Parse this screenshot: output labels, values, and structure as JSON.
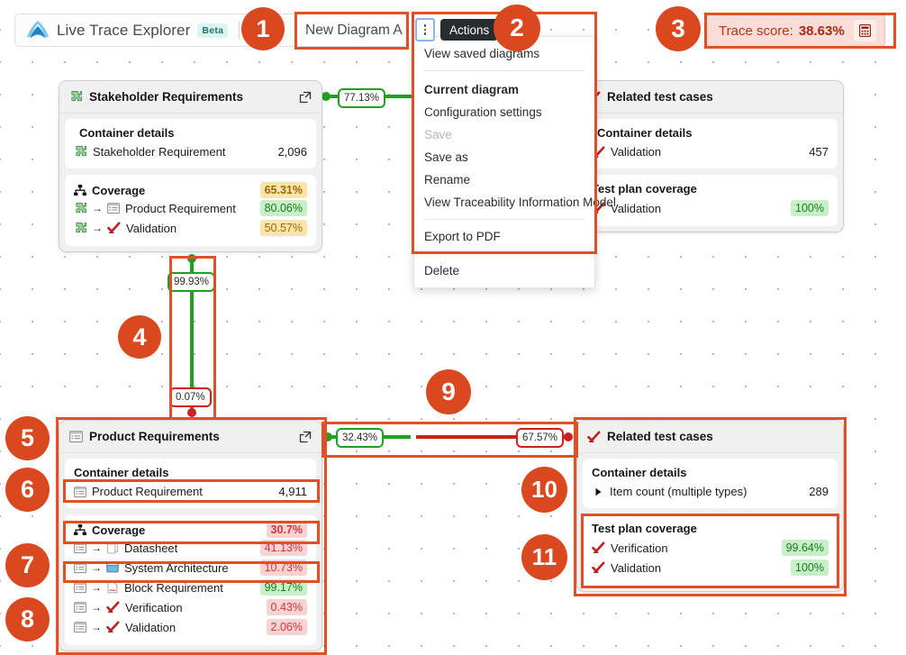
{
  "app": {
    "title": "Live Trace Explorer",
    "badge": "Beta",
    "logo_icon": "live-trace-logo-icon"
  },
  "diagram_name": {
    "value": "New Diagram A"
  },
  "actions": {
    "button_icon": "kebab-menu-icon",
    "tooltip": "Actions",
    "menu": [
      {
        "label": "View saved diagrams",
        "type": "item"
      },
      {
        "type": "separator"
      },
      {
        "label": "Current diagram",
        "type": "header"
      },
      {
        "label": "Configuration settings",
        "type": "item"
      },
      {
        "label": "Save",
        "type": "disabled"
      },
      {
        "label": "Save as",
        "type": "item"
      },
      {
        "label": "Rename",
        "type": "item"
      },
      {
        "label": "View Traceability Information Model",
        "type": "item"
      },
      {
        "type": "separator"
      },
      {
        "label": "Export to PDF",
        "type": "item"
      },
      {
        "type": "separator"
      },
      {
        "label": "Delete",
        "type": "item"
      }
    ]
  },
  "trace_score": {
    "label": "Trace score:",
    "value": "38.63%",
    "icon": "calculator-icon",
    "color": "#b03520",
    "background": "#fbdcd6"
  },
  "cards": {
    "stakeholder": {
      "title": "Stakeholder Requirements",
      "icon": "puzzle-piece-icon",
      "open_icon": "external-link-icon",
      "details_title": "Container details",
      "details_rows": [
        {
          "icon": "puzzle-piece-icon",
          "label": "Stakeholder Requirement",
          "value": "2,096"
        }
      ],
      "coverage_title": "Coverage",
      "coverage_icon": "hierarchy-icon",
      "coverage_value": "65.31%",
      "coverage_color": "amber",
      "coverage_rows": [
        {
          "from_icon": "puzzle-piece-icon",
          "to_icon": "table-icon",
          "label": "Product Requirement",
          "value": "80.06%",
          "color": "green"
        },
        {
          "from_icon": "puzzle-piece-icon",
          "to_icon": "check-mark-icon",
          "label": "Validation",
          "value": "50.57%",
          "color": "amber"
        }
      ]
    },
    "product": {
      "title": "Product Requirements",
      "icon": "table-icon",
      "open_icon": "external-link-icon",
      "details_title": "Container details",
      "details_rows": [
        {
          "icon": "table-icon",
          "label": "Product Requirement",
          "value": "4,911"
        }
      ],
      "coverage_title": "Coverage",
      "coverage_icon": "hierarchy-icon",
      "coverage_value": "30.7%",
      "coverage_color": "red",
      "coverage_rows": [
        {
          "from_icon": "table-icon",
          "to_icon": "copy-icon",
          "label": "Datasheet",
          "value": "41.13%",
          "color": "red"
        },
        {
          "from_icon": "table-icon",
          "to_icon": "window-icon",
          "label": "System Architecture",
          "value": "10.73%",
          "color": "red"
        },
        {
          "from_icon": "table-icon",
          "to_icon": "document-icon",
          "label": "Block Requirement",
          "value": "99.17%",
          "color": "green"
        },
        {
          "from_icon": "table-icon",
          "to_icon": "check-mark-icon",
          "label": "Verification",
          "value": "0.43%",
          "color": "red"
        },
        {
          "from_icon": "table-icon",
          "to_icon": "check-mark-icon",
          "label": "Validation",
          "value": "2.06%",
          "color": "red"
        }
      ]
    },
    "test_cases_top": {
      "title": "Related test cases",
      "icon": "check-mark-icon",
      "details_title": "Container details",
      "details_rows": [
        {
          "icon": "check-mark-icon",
          "label": "Validation",
          "value": "457"
        }
      ],
      "coverage_title": "Test plan coverage",
      "coverage_rows": [
        {
          "icon": "check-mark-icon",
          "label": "Validation",
          "value": "100%",
          "color": "green"
        }
      ]
    },
    "test_cases_bottom": {
      "title": "Related test cases",
      "icon": "check-mark-icon",
      "details_title": "Container details",
      "details_rows": [
        {
          "icon": "triangle-expand-icon",
          "label": "Item count (multiple types)",
          "value": "289"
        }
      ],
      "coverage_title": "Test plan coverage",
      "coverage_rows": [
        {
          "icon": "check-mark-icon",
          "label": "Verification",
          "value": "99.64%",
          "color": "green"
        },
        {
          "icon": "check-mark-icon",
          "label": "Validation",
          "value": "100%",
          "color": "green"
        }
      ]
    }
  },
  "edges": {
    "stakeholder_to_testcases": {
      "label": "77.13%",
      "color": "green"
    },
    "stakeholder_to_product_top": {
      "label": "99.93%",
      "color": "green"
    },
    "stakeholder_to_product_bottom": {
      "label": "0.07%",
      "color": "red"
    },
    "product_to_testcases_left": {
      "label": "32.43%",
      "color": "green"
    },
    "product_to_testcases_right": {
      "label": "67.57%",
      "color": "red"
    }
  },
  "annotations": [
    {
      "number": "1"
    },
    {
      "number": "2"
    },
    {
      "number": "3"
    },
    {
      "number": "4"
    },
    {
      "number": "5"
    },
    {
      "number": "6"
    },
    {
      "number": "7"
    },
    {
      "number": "8"
    },
    {
      "number": "9"
    },
    {
      "number": "10"
    },
    {
      "number": "11"
    }
  ]
}
